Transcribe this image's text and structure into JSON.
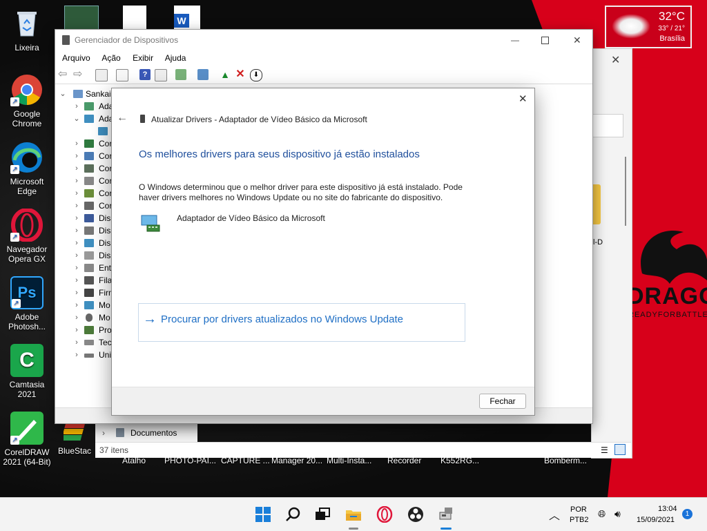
{
  "desktop": {
    "icons": [
      {
        "label": "Lixeira",
        "icon": "recycle-bin-icon"
      },
      {
        "label": "Google Chrome",
        "icon": "chrome-icon"
      },
      {
        "label": "Microsoft Edge",
        "icon": "edge-icon"
      },
      {
        "label": "Navegador Opera GX",
        "icon": "opera-gx-icon"
      },
      {
        "label": "Adobe Photosh...",
        "icon": "photoshop-icon"
      },
      {
        "label": "Camtasia 2021",
        "icon": "camtasia-icon"
      },
      {
        "label": "CorelDRAW 2021 (64-Bit)",
        "icon": "coreldraw-icon"
      },
      {
        "label": "BlueStac",
        "icon": "bluestacks-icon"
      }
    ],
    "bottom_labels": [
      "Atalho",
      "PHOTO-PAI...",
      "CAPTURE ...",
      "Manager 20...",
      "Multi-Insta...",
      "Recorder",
      "K552RG...",
      "Bomberm..."
    ],
    "wallpaper_text": {
      "brand": "DRAGON",
      "tagline": "READYFORBATTLE"
    },
    "weather": {
      "temp": "32°C",
      "range": "33° / 21°",
      "city": "Brasília"
    }
  },
  "explorer": {
    "tree_item": "Documentos",
    "status": "37 itens",
    "partial_label": "l-D"
  },
  "devmgr": {
    "title": "Gerenciador de Dispositivos",
    "menu": [
      "Arquivo",
      "Ação",
      "Exibir",
      "Ajuda"
    ],
    "tree": {
      "root": "SankaiC",
      "items": [
        "Ada",
        "Ada",
        "Cor",
        "Cor",
        "Cor",
        "Cor",
        "Cor",
        "Cor",
        "Disp",
        "Disp",
        "Disp",
        "Disp",
        "Entr",
        "Fila",
        "Firm",
        "Mo",
        "Mo",
        "Pro",
        "Tecl",
        "Uni"
      ]
    }
  },
  "dialog": {
    "header": "Atualizar Drivers - Adaptador de Vídeo Básico da Microsoft",
    "heading": "Os melhores drivers para seus dispositivo já estão instalados",
    "body_line1": "O Windows determinou que o melhor driver para este dispositivo já está instalado. Pode",
    "body_line2": "haver drivers melhores no Windows Update ou no site do fabricante do dispositivo.",
    "device_name": "Adaptador de Vídeo Básico da Microsoft",
    "link": "Procurar por drivers atualizados no Windows Update",
    "close_button": "Fechar"
  },
  "taskbar": {
    "lang_top": "POR",
    "lang_bottom": "PTB2",
    "time": "13:04",
    "date": "15/09/2021",
    "notifications": "1"
  },
  "colors": {
    "accent": "#1f6fc5",
    "wallpaper_red": "#d7001a"
  }
}
